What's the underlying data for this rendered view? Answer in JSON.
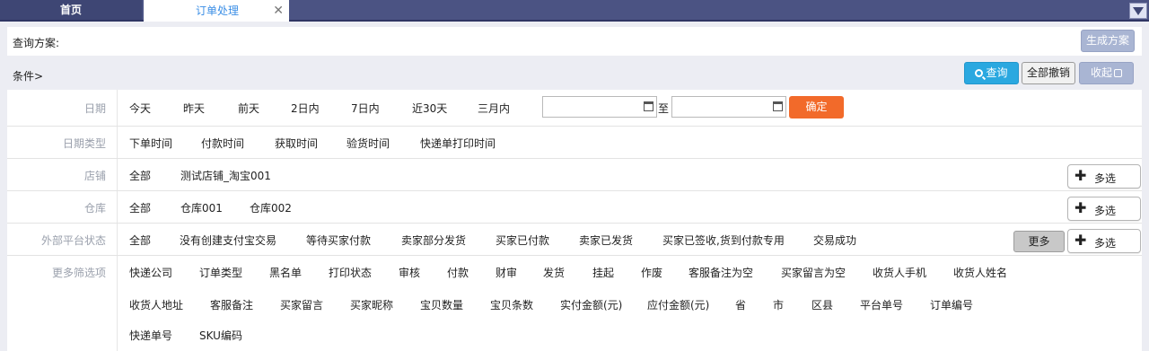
{
  "tabs": {
    "home": "首页",
    "active": "订单处理",
    "close_glyph": "✕"
  },
  "scheme": {
    "label": "查询方案:",
    "generate_button": "生成方案"
  },
  "conditions": {
    "label": "条件>",
    "search_button": "查询",
    "cancel_all_button": "全部撤销",
    "collapse_button": "收起"
  },
  "filters": {
    "date": {
      "label": "日期",
      "options": [
        "今天",
        "昨天",
        "前天",
        "2日内",
        "7日内",
        "近30天",
        "三月内"
      ],
      "from_value": "",
      "to_label": "至",
      "to_value": "",
      "confirm_button": "确定"
    },
    "date_type": {
      "label": "日期类型",
      "options": [
        "下单时间",
        "付款时间",
        "获取时间",
        "验货时间",
        "快递单打印时间"
      ]
    },
    "shop": {
      "label": "店铺",
      "options": [
        "全部",
        "测试店铺_淘宝001"
      ],
      "multi_button": "多选"
    },
    "warehouse": {
      "label": "仓库",
      "options": [
        "全部",
        "仓库001",
        "仓库002"
      ],
      "multi_button": "多选"
    },
    "platform_status": {
      "label": "外部平台状态",
      "options": [
        "全部",
        "没有创建支付宝交易",
        "等待买家付款",
        "卖家部分发货",
        "买家已付款",
        "卖家已发货",
        "买家已签收,货到付款专用",
        "交易成功"
      ],
      "more_button": "更多",
      "multi_button": "多选"
    },
    "more_filters": {
      "label": "更多筛选项",
      "line1": [
        "快递公司",
        "订单类型",
        "黑名单",
        "打印状态",
        "审核",
        "付款",
        "财审",
        "发货",
        "挂起",
        "作废",
        "客服备注为空",
        "买家留言为空",
        "收货人手机",
        "收货人姓名"
      ],
      "line2": [
        "收货人地址",
        "客服备注",
        "买家留言",
        "买家昵称",
        "宝贝数量",
        "宝贝条数",
        "实付金额(元)",
        "应付金额(元)",
        "省",
        "市",
        "区县",
        "平台单号",
        "订单编号"
      ],
      "line3": [
        "快递单号",
        "SKU编码"
      ]
    }
  },
  "colors": {
    "tabbar": "#4b5383",
    "primary_blue": "#2aa8e0",
    "muted_button": "#a9b5d3",
    "confirm_orange": "#f26a2a",
    "row_label": "#9aa0ac"
  },
  "icons": {
    "tab_menu": "triangle-down-icon",
    "search": "search-icon",
    "collapse": "collapse-box-icon",
    "calendar": "calendar-icon",
    "plus": "plus-icon"
  }
}
